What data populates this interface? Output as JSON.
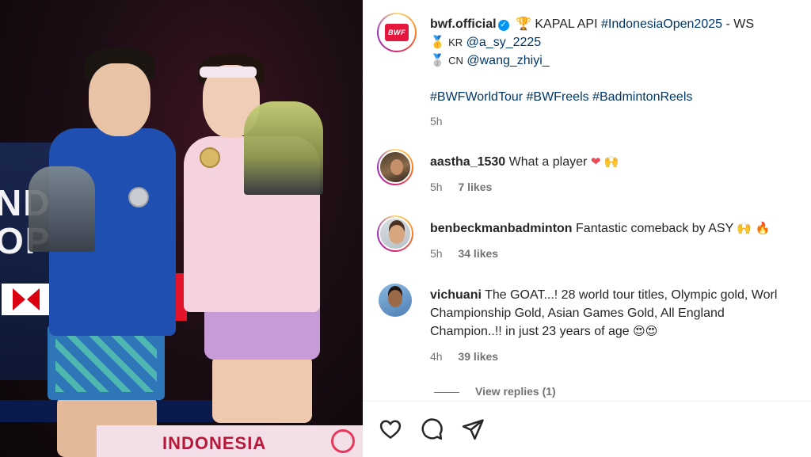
{
  "post": {
    "username": "bwf.official",
    "caption_lead": "🏆 KAPAL API",
    "caption_hashtag": "#IndonesiaOpen2025",
    "caption_tail": " - WS",
    "winner_medal": "🥇",
    "winner_country": "KR",
    "winner_handle": "@a_sy_2225",
    "runnerup_medal": "🥈",
    "runnerup_country": "CN",
    "runnerup_handle": "@wang_zhiyi_",
    "hashtags": "#BWFWorldTour #BWFreels #BadmintonReels",
    "time": "5h",
    "logo_text": "BWF"
  },
  "photo": {
    "backdrop_text": "ND\nOP",
    "podium_text": "INDONESIA"
  },
  "comments": [
    {
      "username": "aastha_1530",
      "text": "What a player",
      "emoji_a": "❤",
      "emoji_b": "🙌",
      "time": "5h",
      "likes": "7 likes"
    },
    {
      "username": "benbeckmanbadminton",
      "text": "Fantastic comeback by ASY",
      "emoji_a": "🙌",
      "emoji_b": "🔥",
      "time": "5h",
      "likes": "34 likes"
    },
    {
      "username": "vichuani",
      "text": "The GOAT...! 28 world tour titles, Olympic gold, Worl",
      "text_line2": "Championship Gold, Asian Games Gold, All England",
      "text_line3": "Champion..!! in just 23 years of age",
      "emoji_a": "😍",
      "emoji_b": "😍",
      "time": "4h",
      "likes": "39 likes",
      "view_replies": "View replies (1)"
    }
  ],
  "icons": {
    "like": "heart-icon",
    "comment": "comment-icon",
    "share": "share-icon"
  }
}
